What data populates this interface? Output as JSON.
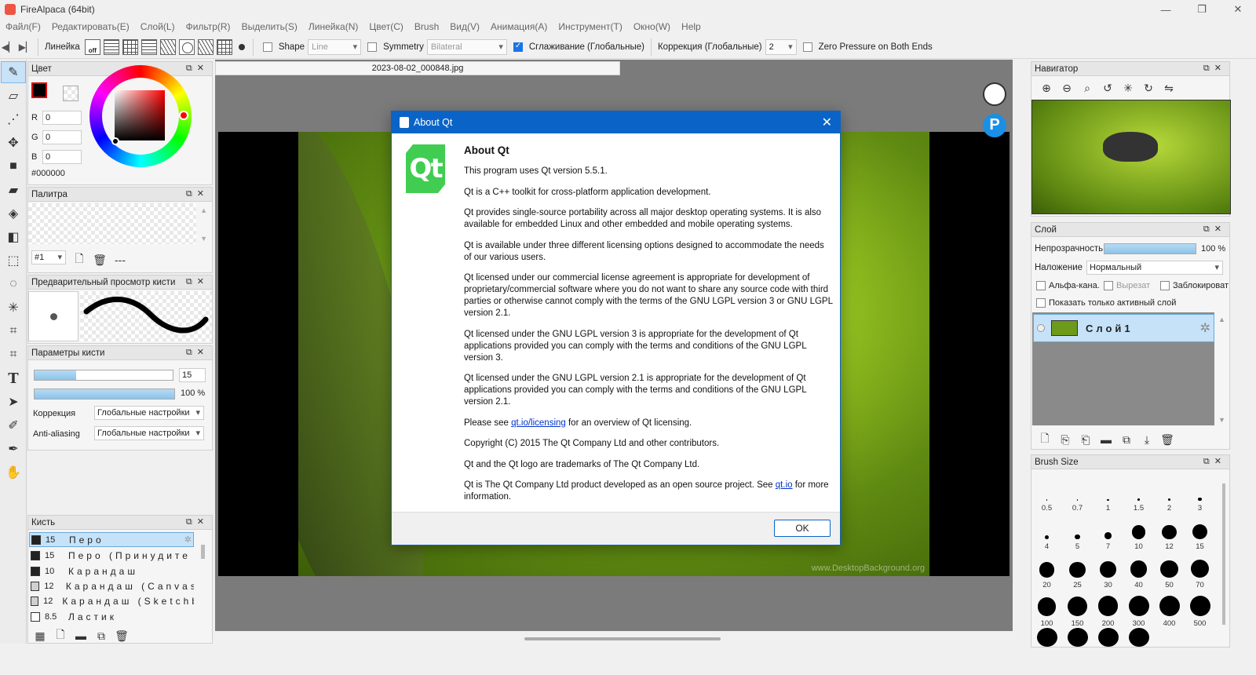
{
  "window": {
    "title": "FireAlpaca (64bit)",
    "min": "—",
    "max": "❐",
    "close": "✕"
  },
  "menu": [
    "Файл(F)",
    "Редактировать(E)",
    "Слой(L)",
    "Фильтр(R)",
    "Выделить(S)",
    "Линейка(N)",
    "Цвет(C)",
    "Brush",
    "Вид(V)",
    "Анимация(A)",
    "Инструмент(T)",
    "Окно(W)",
    "Help"
  ],
  "toolbar": {
    "ruler_label": "Линейка",
    "off_label": "off",
    "shape_label": "Shape",
    "shape_value": "Line",
    "symmetry_label": "Symmetry",
    "symmetry_value": "Bilateral",
    "smoothing_label": "Сглаживание (Глобальные)",
    "correction_label": "Коррекция (Глобальные)",
    "correction_value": "2",
    "zero_pressure_label": "Zero Pressure on Both Ends"
  },
  "color_panel": {
    "title": "Цвет",
    "r_label": "R",
    "r_value": "0",
    "g_label": "G",
    "g_value": "0",
    "b_label": "B",
    "b_value": "0",
    "hex": "#000000",
    "primary_color": "#000000",
    "frame_color": "#e00000"
  },
  "palette_panel": {
    "title": "Палитра",
    "index": "#1",
    "dash": "---"
  },
  "brush_preview_panel": {
    "title": "Предварительный просмотр кисти"
  },
  "brush_params_panel": {
    "title": "Параметры кисти",
    "size_value": "15",
    "size_fill": 0.3,
    "opacity_value": "100 %",
    "opacity_fill": 1.0,
    "correction_label": "Коррекция",
    "correction_value": "Глобальные настройки",
    "aa_label": "Anti-aliasing",
    "aa_value": "Глобальные настройки"
  },
  "brush_panel": {
    "title": "Кисть",
    "items": [
      {
        "size": "15",
        "name": "Перо",
        "color": "#222222"
      },
      {
        "size": "15",
        "name": "Перо (Принудите",
        "color": "#222222"
      },
      {
        "size": "10",
        "name": "Карандаш",
        "color": "#222222"
      },
      {
        "size": "12",
        "name": "Карандаш (Canvas)",
        "color": "#d0d0d0"
      },
      {
        "size": "12",
        "name": "Карандаш (Sketchbook",
        "color": "#d0d0d0"
      },
      {
        "size": "8.5",
        "name": "Ластик",
        "color": "#ffffff"
      }
    ]
  },
  "document": {
    "tab": "2023-08-02_000848.jpg",
    "watermark": "www.DesktopBackground.org"
  },
  "dialog": {
    "title": "About Qt",
    "logo": "Qt",
    "heading": "About Qt",
    "p1": "This program uses Qt version 5.5.1.",
    "p2": "Qt is a C++ toolkit for cross-platform application development.",
    "p3": "Qt provides single-source portability across all major desktop operating systems. It is also available for embedded Linux and other embedded and mobile operating systems.",
    "p4": "Qt is available under three different licensing options designed to accommodate the needs of our various users.",
    "p5": "Qt licensed under our commercial license agreement is appropriate for development of proprietary/commercial software where you do not want to share any source code with third parties or otherwise cannot comply with the terms of the GNU LGPL version 3 or GNU LGPL version 2.1.",
    "p6": "Qt licensed under the GNU LGPL version 3 is appropriate for the development of Qt applications provided you can comply with the terms and conditions of the GNU LGPL version 3.",
    "p7": "Qt licensed under the GNU LGPL version 2.1 is appropriate for the development of Qt applications provided you can comply with the terms and conditions of the GNU LGPL version 2.1.",
    "p8_pre": "Please see ",
    "p8_link": "qt.io/licensing",
    "p8_post": " for an overview of Qt licensing.",
    "p9": "Copyright (C) 2015 The Qt Company Ltd and other contributors.",
    "p10": "Qt and the Qt logo are trademarks of The Qt Company Ltd.",
    "p11_pre": "Qt is The Qt Company Ltd product developed as an open source project. See ",
    "p11_link": "qt.io",
    "p11_post": " for more information.",
    "ok": "OK"
  },
  "navigator_panel": {
    "title": "Навигатор"
  },
  "layer_panel": {
    "title": "Слой",
    "opacity_label": "Непрозрачность",
    "opacity_value": "100 %",
    "blend_label": "Наложение",
    "blend_value": "Нормальный",
    "alpha_label": "Альфа-кана.",
    "clip_label": "Вырезат",
    "lock_label": "Заблокироват",
    "show_active_label": "Показать только активный слой",
    "layer_name": "Слой1"
  },
  "brush_size_panel": {
    "title": "Brush Size",
    "sizes": [
      "0.5",
      "0.7",
      "1",
      "1.5",
      "2",
      "3",
      "4",
      "5",
      "7",
      "10",
      "12",
      "15",
      "20",
      "25",
      "30",
      "40",
      "50",
      "70",
      "100",
      "150",
      "200",
      "300",
      "400",
      "500"
    ]
  }
}
